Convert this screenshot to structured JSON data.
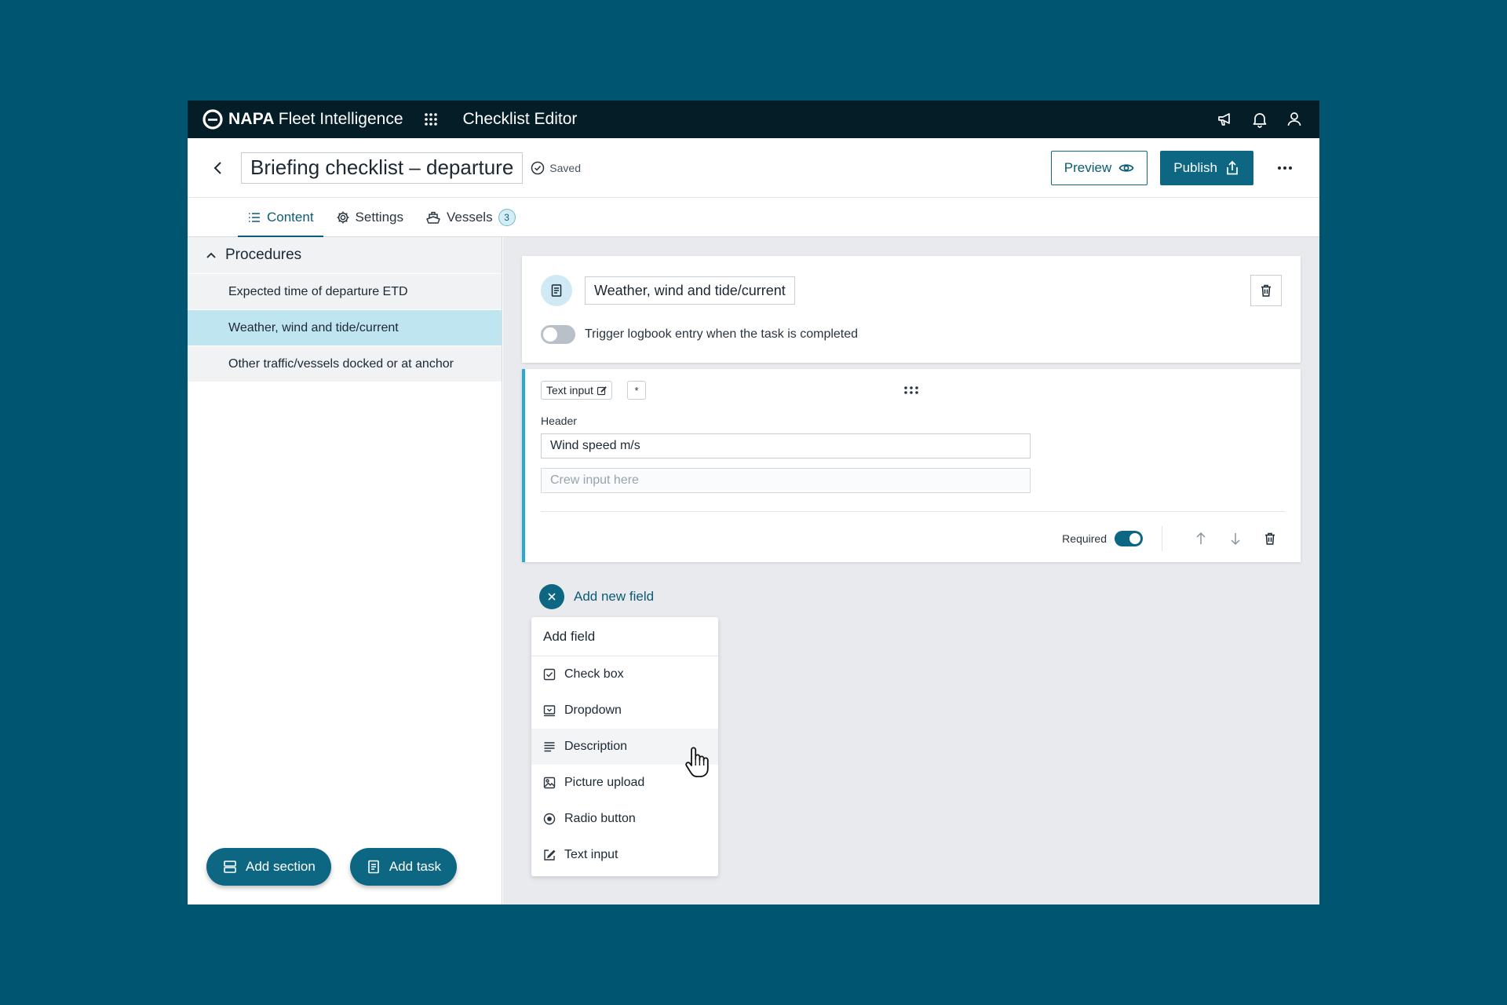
{
  "topbar": {
    "brand_bold": "NAPA",
    "brand_rest": "Fleet Intelligence",
    "app_title": "Checklist Editor"
  },
  "header": {
    "title": "Briefing checklist – departure",
    "saved_label": "Saved",
    "preview_label": "Preview",
    "publish_label": "Publish"
  },
  "tabs": [
    {
      "label": "Content",
      "active": true
    },
    {
      "label": "Settings"
    },
    {
      "label": "Vessels",
      "badge": "3"
    }
  ],
  "sidebar": {
    "section_title": "Procedures",
    "items": [
      {
        "label": "Expected time of departure ETD"
      },
      {
        "label": "Weather, wind and tide/current",
        "selected": true
      },
      {
        "label": "Other traffic/vessels docked or at anchor"
      }
    ],
    "add_section_label": "Add section",
    "add_task_label": "Add task"
  },
  "task": {
    "title": "Weather, wind and tide/current",
    "trigger_label": "Trigger logbook entry when the task is completed",
    "trigger_on": false
  },
  "field": {
    "type_chip": "Text input",
    "required_chip": "*",
    "header_label": "Header",
    "header_value": "Wind speed m/s",
    "crew_placeholder": "Crew input here",
    "required_label": "Required",
    "required_on": true
  },
  "add_new_label": "Add new field",
  "add_field_menu": {
    "title": "Add field",
    "items": [
      "Check box",
      "Dropdown",
      "Description",
      "Picture upload",
      "Radio button",
      "Text input"
    ],
    "hovered": "Description"
  },
  "colors": {
    "outer_bg": "#005570",
    "topbar_bg": "#051d27",
    "accent": "#0d6783",
    "selected_item": "#bfe5f1",
    "field_accent": "#2aa8cf"
  }
}
